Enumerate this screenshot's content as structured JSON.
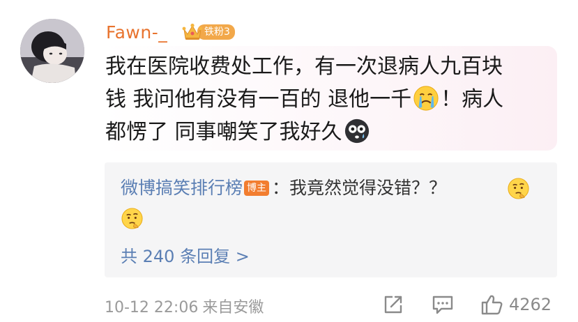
{
  "user": {
    "name": "Fawn-_",
    "fan_badge": "铁粉3"
  },
  "comment": {
    "line1": "我在医院收费处工作，有一次退病人九百块",
    "line2_a": "钱 我问他有没有一百的 退他一千",
    "line2_b": "！病人",
    "line3": "都愣了 同事嘲笑了我好久"
  },
  "reply": {
    "author": "微博搞笑排行榜",
    "author_badge": "博主",
    "text": "：我竟然觉得没错？？",
    "count_text": "共 240 条回复 >"
  },
  "footer": {
    "timestamp": "10-12 22:06",
    "location": "来自安徽",
    "like_count": "4262"
  },
  "colors": {
    "username": "#e8732e",
    "link_blue": "#5b7fb4",
    "badge_orange": "#f27d2f"
  },
  "icons": [
    "crown-icon",
    "crying-face-emoji",
    "shocked-face-emoji",
    "thinking-face-emoji",
    "share-icon",
    "comment-icon",
    "thumbs-up-icon"
  ]
}
